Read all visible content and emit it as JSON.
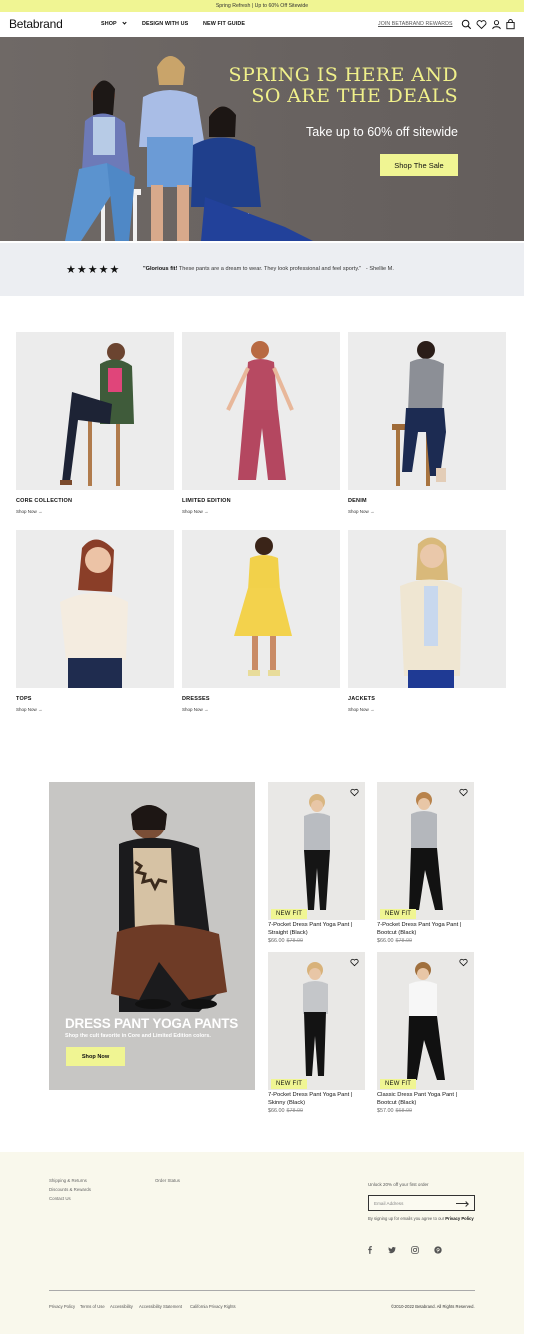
{
  "promo_bar": {
    "text": "Spring Refresh | Up to 60% Off Sitewide"
  },
  "header": {
    "logo": "Betabrand",
    "nav": [
      "SHOP",
      "DESIGN WITH US",
      "NEW FIT GUIDE"
    ],
    "join_link": "JOIN BETABRAND REWARDS",
    "icons": [
      "search-icon",
      "heart-icon",
      "account-icon",
      "bag-icon"
    ]
  },
  "hero": {
    "headline_line1": "SPRING IS HERE AND",
    "headline_line2": "SO ARE THE DEALS",
    "subhead": "Take up to 60% off sitewide",
    "cta": "Shop The Sale"
  },
  "review": {
    "stars": "★★★★★",
    "rating": 5,
    "quote_bold": "\"Glorious fit!",
    "quote_rest": " These pants are a dream to wear. They look professional and feel sporty.\"",
    "author": "- Shellie M."
  },
  "categories": [
    {
      "title": "CORE COLLECTION",
      "link": "Shop Now →"
    },
    {
      "title": "LIMITED EDITION",
      "link": "Shop Now →"
    },
    {
      "title": "DENIM",
      "link": "Shop Now →"
    },
    {
      "title": "TOPS",
      "link": "Shop Now →"
    },
    {
      "title": "DRESSES",
      "link": "Shop Now →"
    },
    {
      "title": "JACKETS",
      "link": "Shop Now →"
    }
  ],
  "feature": {
    "title": "DRESS PANT YOGA PANTS",
    "subtitle": "Shop the cult favorite in Core and Limited Edition colors.",
    "cta": "Shop Now"
  },
  "products": [
    {
      "badge": "NEW FIT",
      "name_line1": "7-Pocket Dress Pant Yoga Pant |",
      "name_line2": "Straight (Black)",
      "price": "$66.00",
      "old_price": "$78.00"
    },
    {
      "badge": "NEW FIT",
      "name_line1": "7-Pocket Dress Pant Yoga Pant |",
      "name_line2": "Bootcut (Black)",
      "price": "$66.00",
      "old_price": "$78.00"
    },
    {
      "badge": "NEW FIT",
      "name_line1": "7-Pocket Dress Pant Yoga Pant |",
      "name_line2": "Skinny (Black)",
      "price": "$66.00",
      "old_price": "$78.00"
    },
    {
      "badge": "NEW FIT",
      "name_line1": "Classic Dress Pant Yoga Pant |",
      "name_line2": "Bootcut (Black)",
      "price": "$57.00",
      "old_price": "$68.00"
    }
  ],
  "footer": {
    "links_col1": [
      "Shipping & Returns",
      "Discounts & Rewards",
      "Contact Us"
    ],
    "links_col2": [
      "Order Status"
    ],
    "unlock": "Unlock 20% off your first order",
    "email_placeholder": "Email Address",
    "signup_note": "By signing up for emails you agree to our ",
    "privacy_policy": "Privacy Policy",
    "social_icons": [
      "facebook-icon",
      "twitter-icon",
      "instagram-icon",
      "pinterest-icon"
    ],
    "legal_links": [
      "Privacy Policy",
      "Terms of Use",
      "Accessibility",
      "Accessibility Statement",
      "California Privacy Rights"
    ],
    "copyright": "©2010-2022 Betabrand. All Rights Reserved."
  },
  "colors": {
    "accent": "#f0f593",
    "hero_bg": "#6b6562",
    "headline": "#f0f08a",
    "footer_bg": "#f9f8ec"
  }
}
